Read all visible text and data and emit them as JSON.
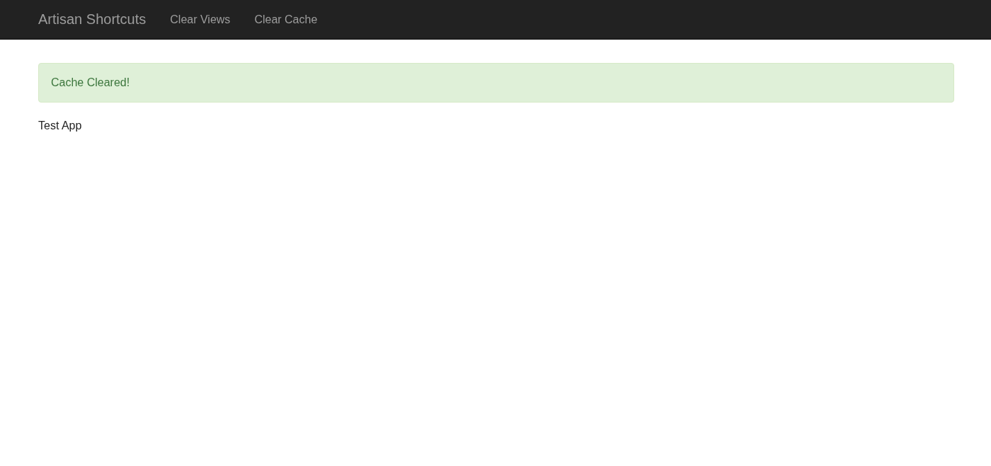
{
  "navbar": {
    "brand": "Artisan Shortcuts",
    "links": [
      "Clear Views",
      "Clear Cache"
    ]
  },
  "alert": {
    "kind": "success",
    "message": "Cache Cleared!"
  },
  "content": {
    "text": "Test App"
  }
}
